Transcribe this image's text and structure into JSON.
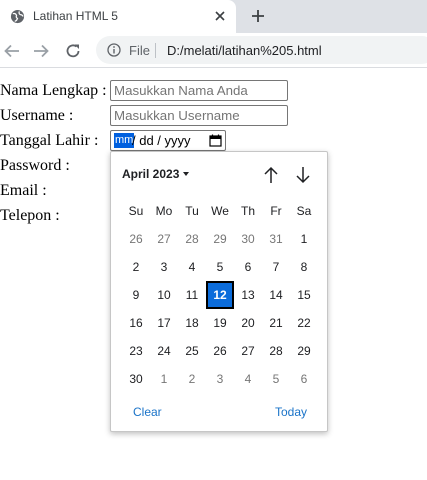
{
  "browser": {
    "tab_title": "Latihan HTML 5",
    "omnibox_scheme": "File",
    "url": "D:/melati/latihan%205.html"
  },
  "form": {
    "nama_label": "Nama Lengkap :",
    "nama_placeholder": "Masukkan Nama Anda",
    "username_label": "Username :",
    "username_placeholder": "Masukkan Username",
    "tanggal_label": "Tanggal Lahir :",
    "date_mm": "mm",
    "date_rest": "/ dd / yyyy",
    "password_label": "Password :",
    "email_label": "Email :",
    "telepon_label": "Telepon :"
  },
  "datepicker": {
    "month_year": "April 2023",
    "weekdays": [
      "Su",
      "Mo",
      "Tu",
      "We",
      "Th",
      "Fr",
      "Sa"
    ],
    "weeks": [
      [
        "26",
        "27",
        "28",
        "29",
        "30",
        "31",
        "1"
      ],
      [
        "2",
        "3",
        "4",
        "5",
        "6",
        "7",
        "8"
      ],
      [
        "9",
        "10",
        "11",
        "12",
        "13",
        "14",
        "15"
      ],
      [
        "16",
        "17",
        "18",
        "19",
        "20",
        "21",
        "22"
      ],
      [
        "23",
        "24",
        "25",
        "26",
        "27",
        "28",
        "29"
      ],
      [
        "30",
        "1",
        "2",
        "3",
        "4",
        "5",
        "6"
      ]
    ],
    "selected_day": "12",
    "clear_label": "Clear",
    "today_label": "Today"
  }
}
